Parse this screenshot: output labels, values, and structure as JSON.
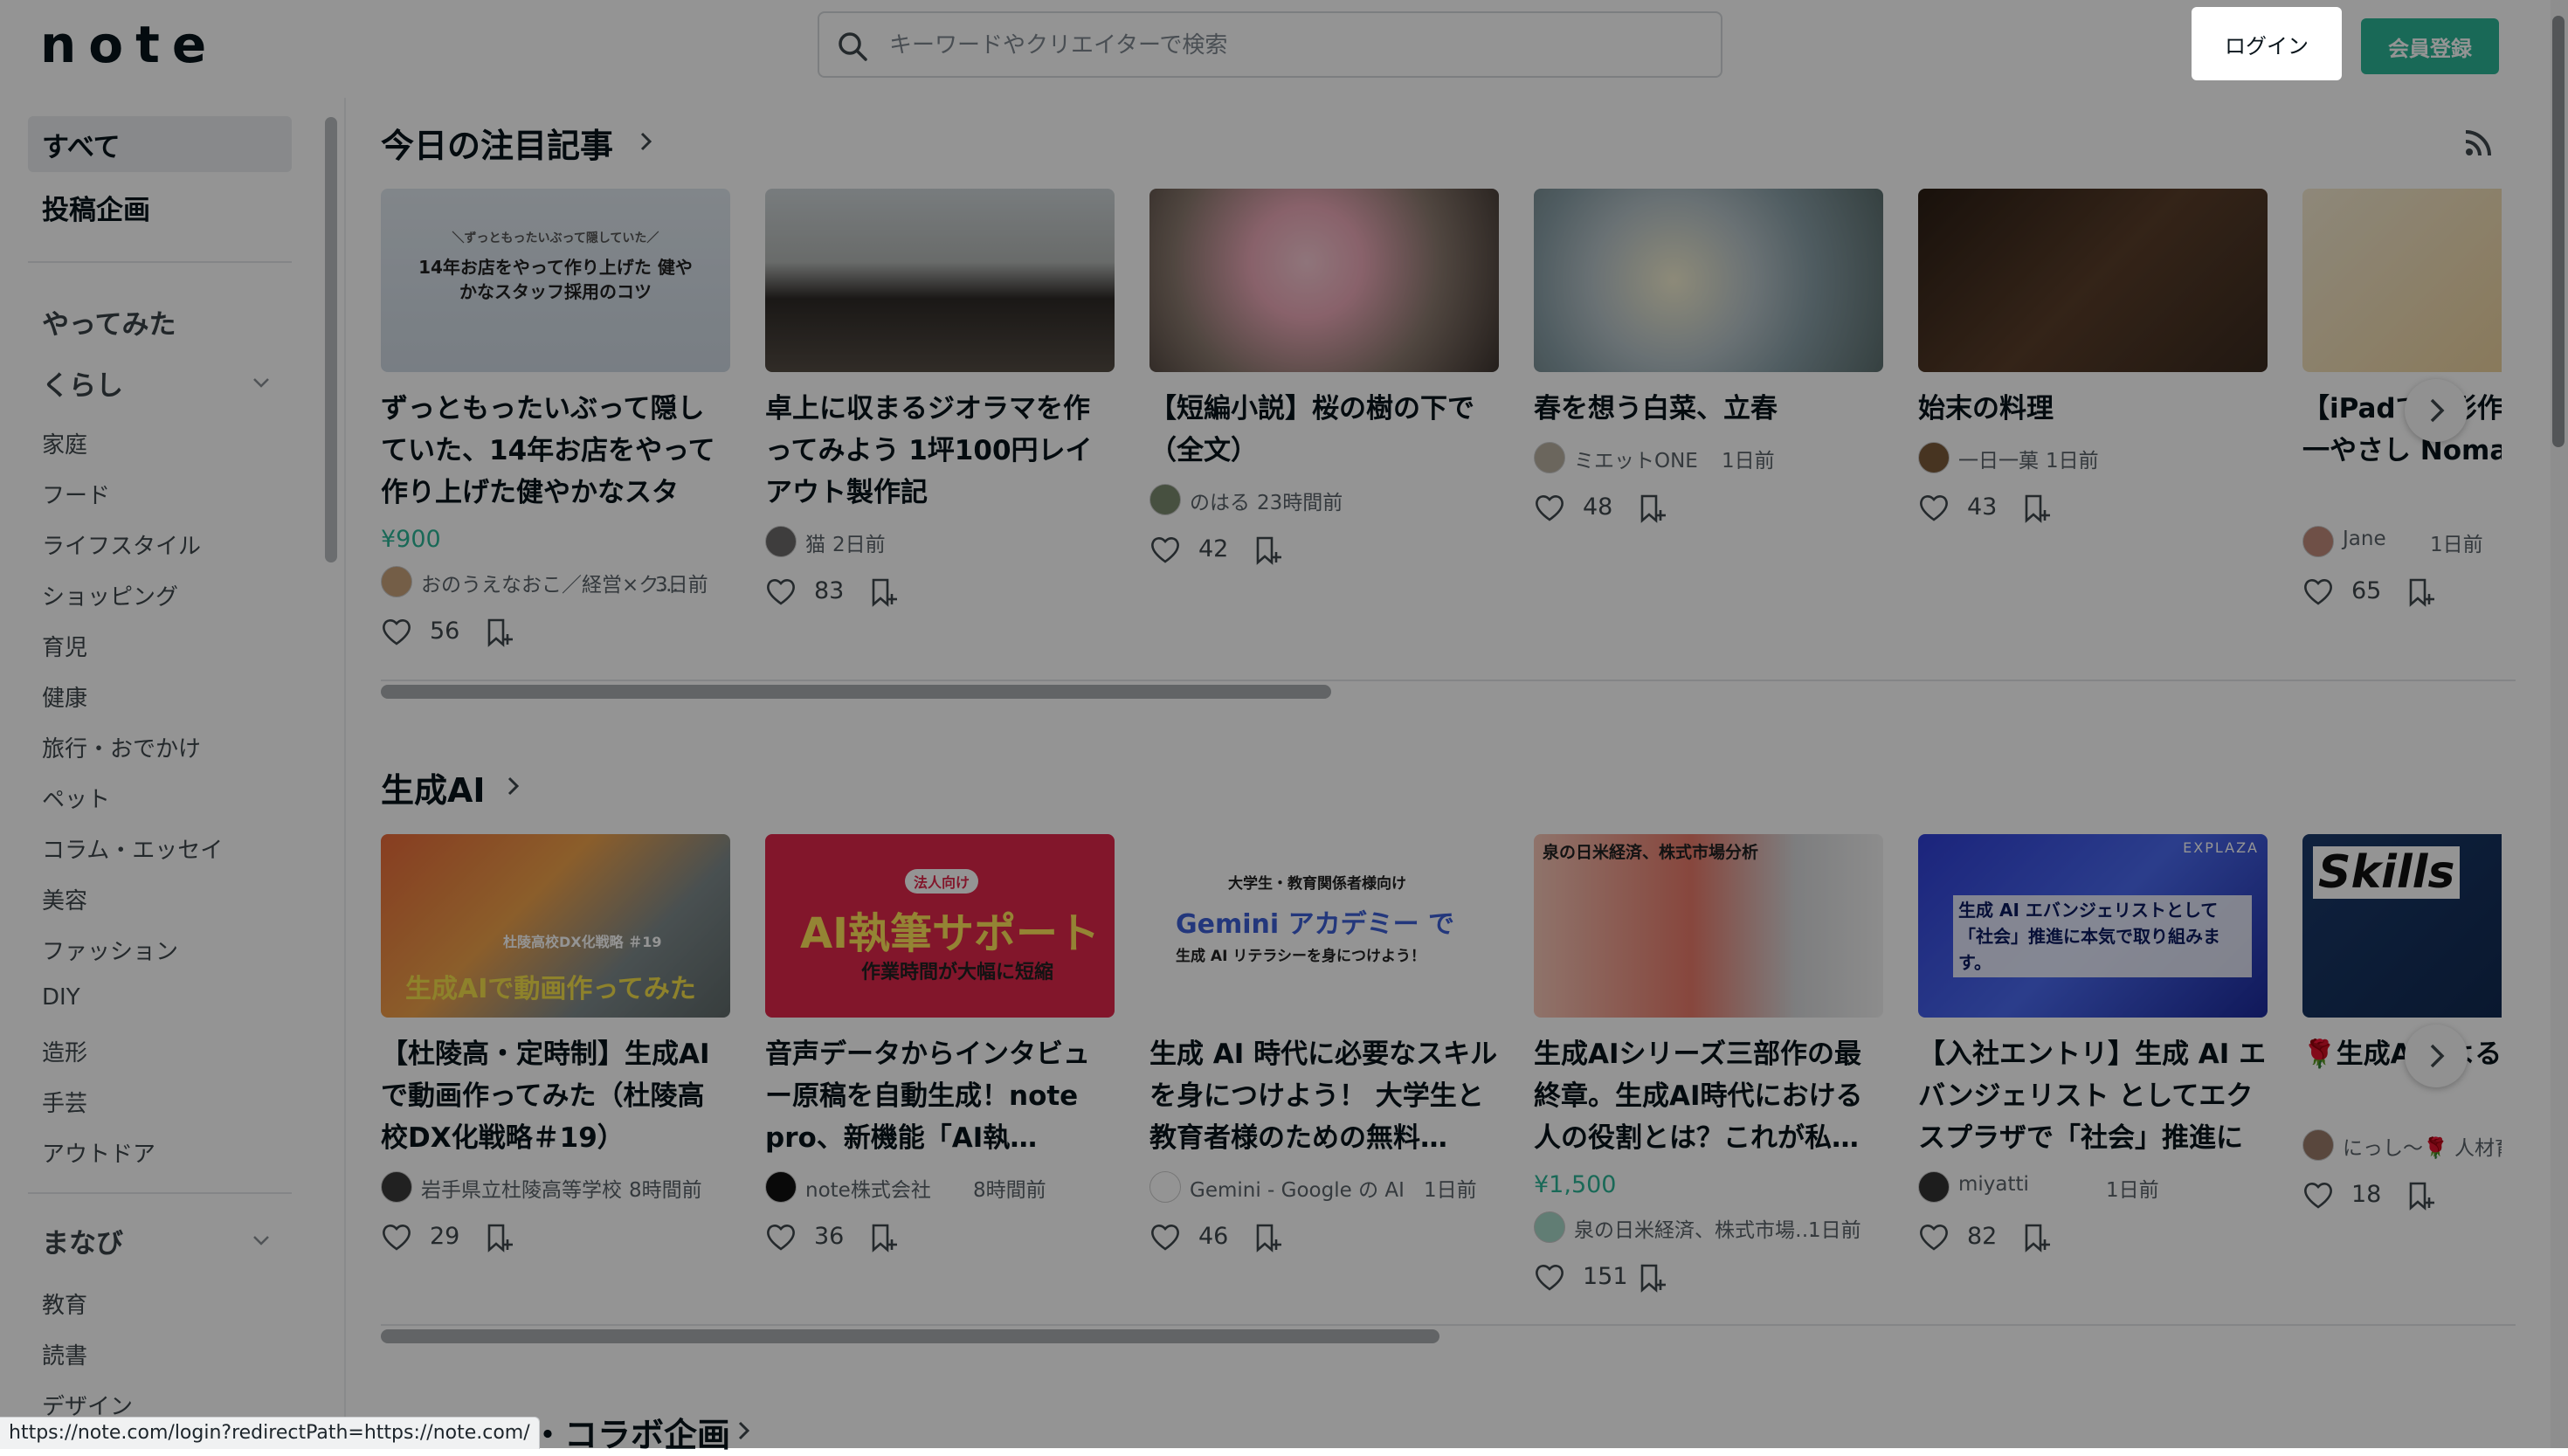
{
  "header": {
    "logo": "note",
    "search_placeholder": "キーワードやクリエイターで検索",
    "login_label": "ログイン",
    "signup_label": "会員登録"
  },
  "sidebar": {
    "top_items": [
      {
        "label": "すべて",
        "active": true
      },
      {
        "label": "投稿企画",
        "active": false
      }
    ],
    "yattemita": "やってみた",
    "kurashi": {
      "label": "くらし",
      "items": [
        "家庭",
        "フード",
        "ライフスタイル",
        "ショッピング",
        "育児",
        "健康",
        "旅行・おでかけ",
        "ペット",
        "コラム・エッセイ",
        "美容",
        "ファッション",
        "DIY",
        "造形",
        "手芸",
        "アウトドア"
      ]
    },
    "manabi": {
      "label": "まなび",
      "items": [
        "教育",
        "読書",
        "デザイン"
      ]
    }
  },
  "sections": [
    {
      "title": "今日の注目記事",
      "cards": [
        {
          "title": "ずっともったいぶって隠していた、14年お店をやって作り上げた健やかなスタッ…",
          "price": "¥900",
          "author": "おのうえなおこ／経営×ク…",
          "time": "3日前",
          "likes": "56",
          "thumb_text": "14年お店をやって作り上げた 健やかなスタッフ採用のコツ",
          "thumb_sub": "＼ずっともったいぶって隠していた／"
        },
        {
          "title": "卓上に収まるジオラマを作ってみよう 1坪100円レイアウト製作記",
          "price": "",
          "author": "猫",
          "time": "2日前",
          "likes": "83"
        },
        {
          "title": "【短編小説】桜の樹の下で（全文）",
          "price": "",
          "author": "のはる",
          "time": "23時間前",
          "likes": "42"
        },
        {
          "title": "春を想う白菜、立春",
          "price": "",
          "author": "ミエットONE",
          "time": "1日前",
          "likes": "48"
        },
        {
          "title": "始末の料理",
          "price": "",
          "author": "一日一菓",
          "time": "1日前",
          "likes": "43"
        },
        {
          "title": "【iPadで造形作品 版！世界一やさし NomadSculpt",
          "price": "",
          "author": "Jane",
          "time": "1日前",
          "likes": "65"
        }
      ]
    },
    {
      "title": "生成AI",
      "cards": [
        {
          "title": "【杜陵高・定時制】生成AIで動画作ってみた（杜陵高校DX化戦略＃19）",
          "price": "",
          "author": "岩手県立杜陵高等学校",
          "time": "8時間前",
          "likes": "29",
          "thumb_text": "生成AIで動画作ってみた",
          "thumb_sub": "杜陵高校DX化戦略 ＃19"
        },
        {
          "title": "音声データからインタビュー原稿を自動生成！note pro、新機能「AI執…",
          "price": "",
          "author": "note株式会社",
          "time": "8時間前",
          "likes": "36",
          "thumb_text": "AI執筆サポート",
          "thumb_sub": "作業時間が大幅に短縮",
          "thumb_badge": "法人向け"
        },
        {
          "title": "生成 AI 時代に必要なスキルを身につけよう！ 大学生と教育者様のための無料…",
          "price": "",
          "author": "Gemini - Google の AI",
          "time": "1日前",
          "likes": "46",
          "thumb_text": "Gemini アカデミー で",
          "thumb_sub": "生成 AI リテラシーを身につけよう！",
          "thumb_top": "大学生・教育関係者様向け"
        },
        {
          "title": "生成AIシリーズ三部作の最終章。生成AI時代における人の役割とは？これが私…",
          "price": "¥1,500",
          "author": "泉の日米経済、株式市場…",
          "time": "1日前",
          "likes": "151",
          "thumb_text": "泉の日米経済、株式市場分析"
        },
        {
          "title": "【入社エントリ】生成 AI エバンジェリスト としてエクスプラザで「社会」推進に本…",
          "price": "",
          "author": "miyatti",
          "time": "1日前",
          "likes": "82",
          "thumb_text": "生成 AI エバンジェリストとして 「社会」推進に本気で取り組みます。",
          "thumb_brand": "EXPLAZA"
        },
        {
          "title": "🌹生成AIによる 革の最前線",
          "price": "",
          "author": "にっし～🌹 人材育",
          "time": "",
          "likes": "18",
          "thumb_text": "Skills"
        }
      ]
    },
    {
      "title": "ト・コラボ企画"
    }
  ],
  "status_url": "https://note.com/login?redirectPath=https://note.com/",
  "colors": {
    "accent": "#2cb696",
    "overlay": "rgba(0,0,0,0.42)"
  }
}
